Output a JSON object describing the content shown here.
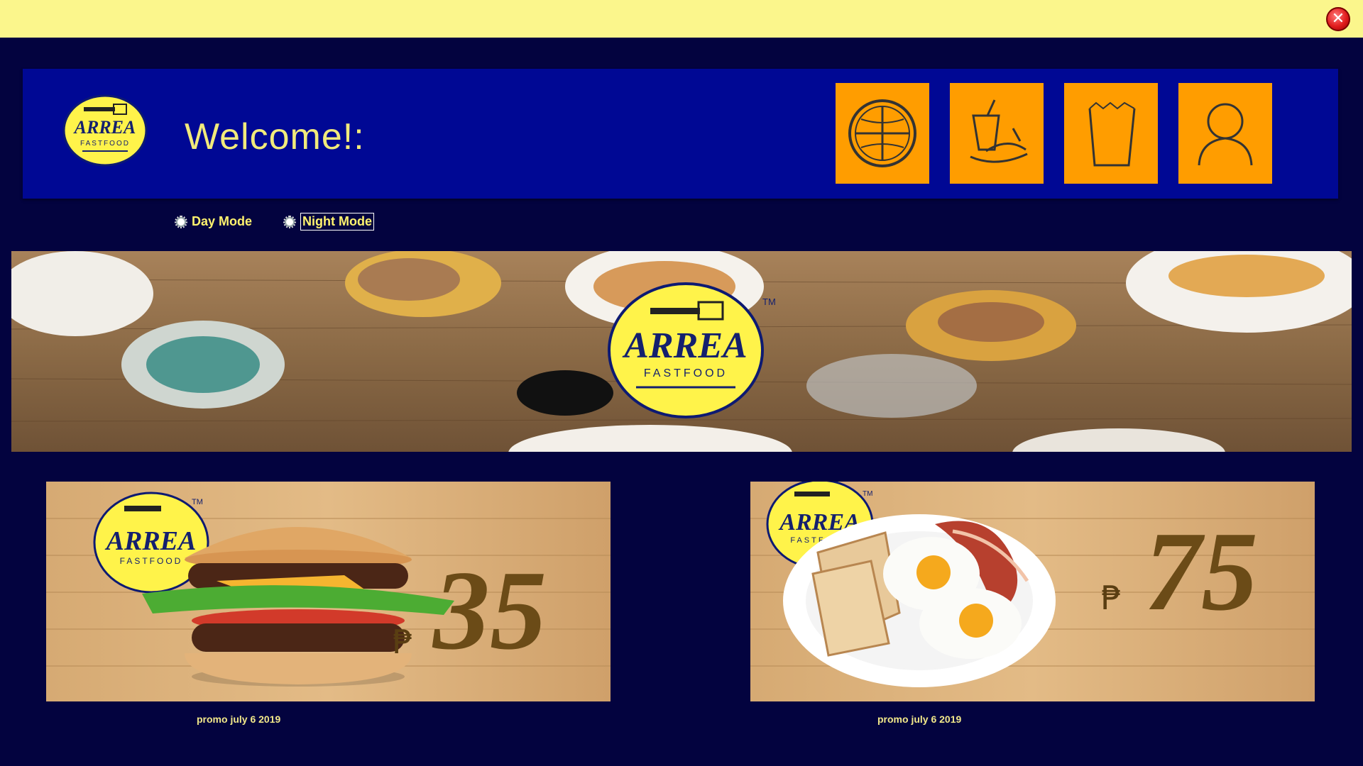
{
  "window": {
    "close_icon": "close-icon",
    "close_glyph": "✕",
    "titlebar_color": "#fbf68c"
  },
  "header": {
    "welcome": "Welcome!:",
    "background": "#000894",
    "nav": [
      {
        "name": "globe-icon"
      },
      {
        "name": "food-icon"
      },
      {
        "name": "cup-icon"
      },
      {
        "name": "user-icon"
      }
    ],
    "tile_color": "#ff9d00"
  },
  "modes": {
    "day_label": "Day Mode",
    "night_label": "Night Mode",
    "selected": "Night Mode"
  },
  "brand": {
    "name": "ARREA",
    "sub": "FASTFOOD",
    "tm": "TM"
  },
  "promos": [
    {
      "currency": "₱",
      "price": "35",
      "caption": "promo july 6 2019",
      "item": "burger"
    },
    {
      "currency": "₱",
      "price": "75",
      "caption": "promo july 6 2019",
      "item": "breakfast"
    }
  ]
}
